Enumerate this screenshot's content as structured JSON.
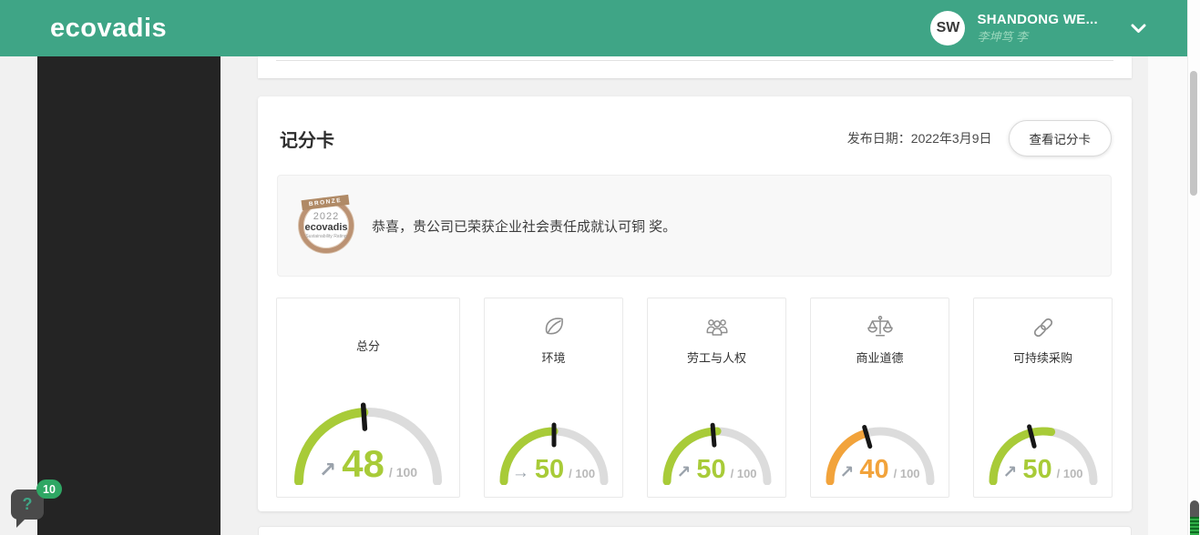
{
  "header": {
    "logo": "ecovadis",
    "user": {
      "initials": "SW",
      "name": "SHANDONG WE...",
      "subtitle": "李坤笃 李"
    }
  },
  "scorecard": {
    "title": "记分卡",
    "published": "发布日期：2022年3月9日",
    "view_button": "查看记分卡",
    "banner": {
      "message": "恭喜，贵公司已荣获企业社会责任成就认可铜 奖。",
      "medal": {
        "level": "BRONZE",
        "year": "2022",
        "brand": "ecovadis",
        "tagline": "Sustainability Rating"
      }
    }
  },
  "help": {
    "badge_count": "10",
    "icon": "?"
  },
  "colors": {
    "brand_green": "#3FA586",
    "badge_green": "#2FA764",
    "gauge_green": "#A8CB38",
    "gauge_orange": "#F2A33B",
    "needle_black": "#161616",
    "track_gray": "#dcdcdc"
  },
  "chart_data": {
    "type": "gauge",
    "max": 100,
    "max_label": "/ 100",
    "gauges": [
      {
        "id": "total",
        "label": "总分",
        "value": 48,
        "trend": "up",
        "color": "green",
        "fill_pct": 48,
        "needle_pct": 48,
        "icon": null,
        "size": "large"
      },
      {
        "id": "environment",
        "label": "环境",
        "value": 50,
        "trend": "stable",
        "color": "green",
        "fill_pct": 50,
        "needle_pct": 50,
        "icon": "leaf-icon",
        "size": "small"
      },
      {
        "id": "labor-rights",
        "label": "劳工与人权",
        "value": 50,
        "trend": "up",
        "color": "green",
        "fill_pct": 50,
        "needle_pct": 47.5,
        "icon": "people-icon",
        "size": "small"
      },
      {
        "id": "ethics",
        "label": "商业道德",
        "value": 40,
        "trend": "up",
        "color": "orange",
        "fill_pct": 40,
        "needle_pct": 41,
        "icon": "scales-icon",
        "size": "small"
      },
      {
        "id": "sust-procurement",
        "label": "可持续采购",
        "value": 50,
        "trend": "up",
        "color": "green",
        "fill_pct": 55,
        "needle_pct": 42,
        "icon": "chain-icon",
        "size": "small"
      }
    ],
    "trend_glyphs": {
      "up": "↗",
      "stable": "→"
    }
  }
}
